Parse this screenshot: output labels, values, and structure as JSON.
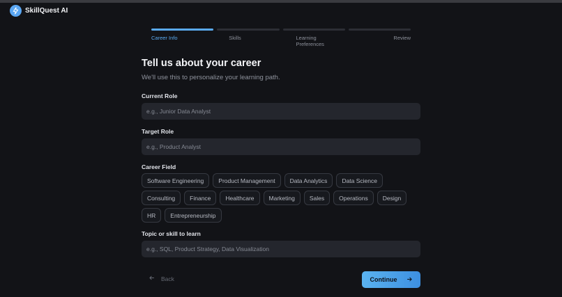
{
  "app": {
    "name": "SkillQuest AI"
  },
  "steps": [
    {
      "label": "Career Info",
      "active": true
    },
    {
      "label": "Skills",
      "active": false
    },
    {
      "label": "Learning Preferences",
      "active": false
    },
    {
      "label": "Review",
      "active": false
    }
  ],
  "form": {
    "title": "Tell us about your career",
    "subtitle": "We'll use this to personalize your learning path.",
    "current_role": {
      "label": "Current Role",
      "placeholder": "e.g., Junior Data Analyst",
      "value": ""
    },
    "target_role": {
      "label": "Target Role",
      "placeholder": "e.g., Product Analyst",
      "value": ""
    },
    "career_field": {
      "label": "Career Field",
      "options": [
        "Software Engineering",
        "Product Management",
        "Data Analytics",
        "Data Science",
        "Consulting",
        "Finance",
        "Healthcare",
        "Marketing",
        "Sales",
        "Operations",
        "Design",
        "HR",
        "Entrepreneurship"
      ]
    },
    "topic": {
      "label": "Topic or skill to learn",
      "placeholder": "e.g., SQL, Product Strategy, Data Visualization",
      "value": ""
    }
  },
  "actions": {
    "back_label": "Back",
    "continue_label": "Continue"
  },
  "colors": {
    "accent": "#5aaaf0",
    "background": "#121317",
    "input_bg": "#24262d"
  },
  "icons": {
    "logo": "lightning-bolt-icon",
    "back": "arrow-left-icon",
    "continue": "arrow-right-icon"
  }
}
